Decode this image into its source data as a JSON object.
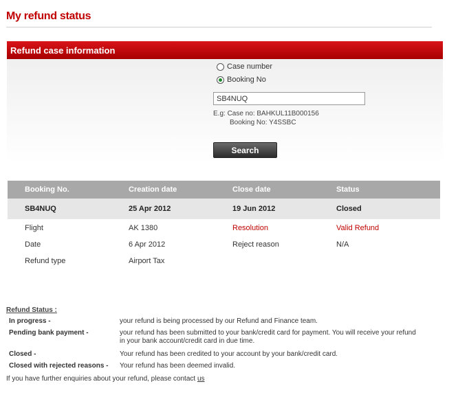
{
  "page_title": "My refund status",
  "panel": {
    "header": "Refund case information",
    "radio_options": [
      {
        "label": "Case number",
        "checked": false
      },
      {
        "label": "Booking No",
        "checked": true
      }
    ],
    "input_value": "SB4NUQ",
    "example_line1": "E.g: Case no: BAHKUL11B000156",
    "example_line2": "Booking No: Y4SSBC",
    "search_label": "Search"
  },
  "table": {
    "headers": [
      "Booking No.",
      "Creation date",
      "Close date",
      "Status"
    ],
    "summary": [
      "SB4NUQ",
      "25 Apr 2012",
      "19 Jun 2012",
      "Closed"
    ],
    "details": {
      "flight_label": "Flight",
      "flight_value": "AK 1380",
      "resolution_label": "Resolution",
      "resolution_value": "Valid Refund",
      "date_label": "Date",
      "date_value": "6 Apr 2012",
      "reject_label": "Reject reason",
      "reject_value": "N/A",
      "type_label": "Refund type",
      "type_value": "Airport Tax"
    }
  },
  "legend": {
    "title": "Refund Status :",
    "items": [
      {
        "term": "In progress -",
        "desc": "your refund is being processed by our Refund and Finance team."
      },
      {
        "term": "Pending bank payment -",
        "desc": "your refund has been submitted to your bank/credit card for payment. You will receive your refund in your bank account/credit card in due time."
      },
      {
        "term": "Closed -",
        "desc": "Your refund has been credited to your account by your bank/credit card."
      },
      {
        "term": "Closed with rejected reasons -",
        "desc": "Your refund has been deemed invalid."
      }
    ]
  },
  "footer": {
    "text": "If you have further enquiries about your refund, please contact ",
    "link": "us"
  },
  "colors": {
    "brand_red": "#c00000",
    "table_header": "#a8a8a8",
    "radio_checked": "#1f8a2e"
  }
}
